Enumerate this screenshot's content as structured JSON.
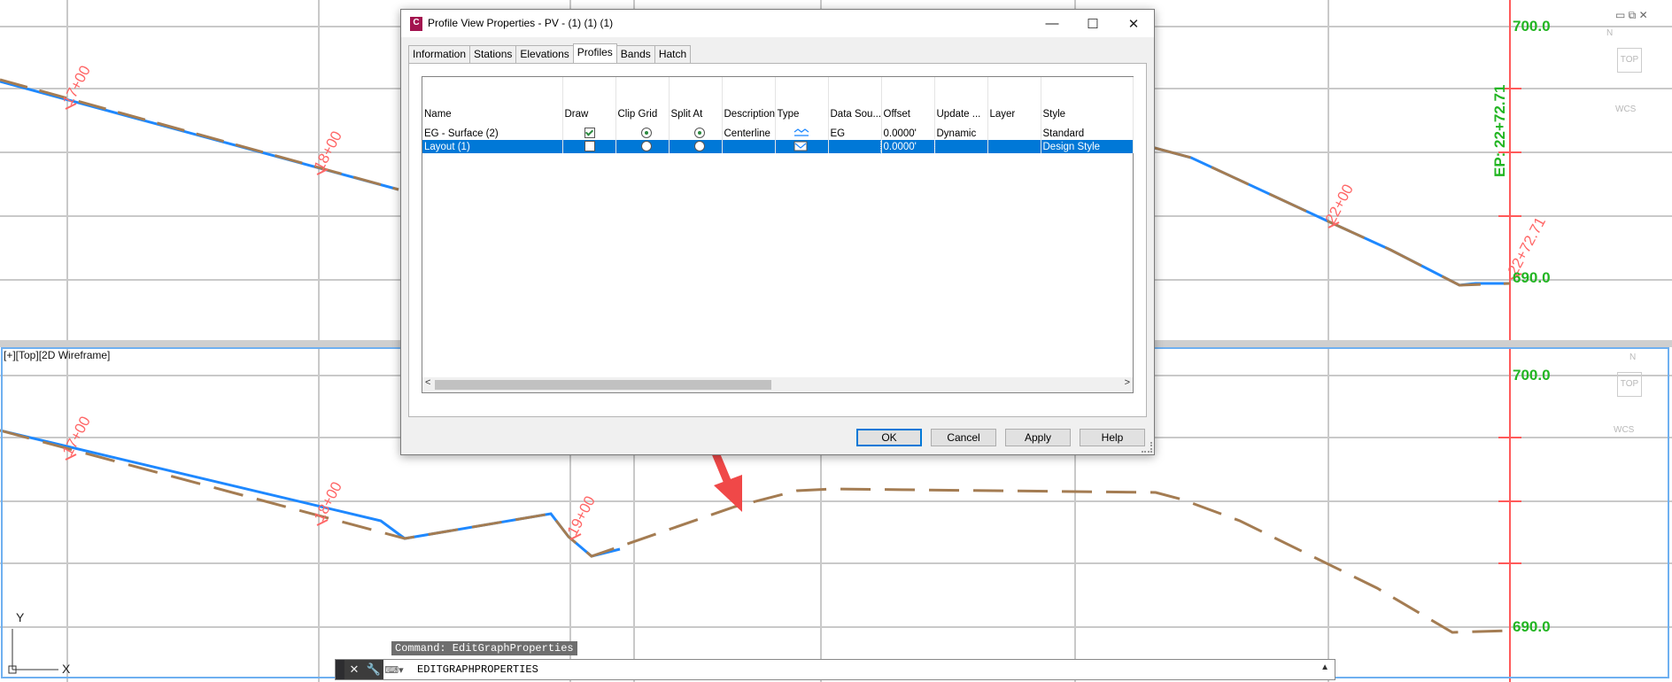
{
  "colors": {
    "grid": "#c9c9c9",
    "stationText": "#ff6666",
    "redLine": "#ff5a5a",
    "surfaceBrown": "#a47c52",
    "layoutBlue": "#1e88ff",
    "elevGreen": "#22b522",
    "arrow": "#f04848"
  },
  "topViewport": {
    "stations": [
      "17+00",
      "18+00",
      "22+00",
      "22+72.71"
    ],
    "elevTop": "700.0",
    "elevBottom": "690.0",
    "endStation": "EP:  22+72.71",
    "viewcube": {
      "top": "TOP",
      "wcs": "WCS"
    }
  },
  "bottomViewport": {
    "label": "[+][Top][2D Wireframe]",
    "stations": [
      "17+00",
      "18+00",
      "19+00"
    ],
    "elevTop": "700.0",
    "elevBottom": "690.0",
    "viewcube": {
      "top": "TOP",
      "wcs": "WCS"
    }
  },
  "ucs": {
    "x": "X",
    "y": "Y"
  },
  "command": {
    "hint": "Command: EditGraphProperties",
    "text": "EDITGRAPHPROPERTIES",
    "close_icon": "close-icon",
    "wrench_icon": "wrench-icon"
  },
  "dialog": {
    "title": "Profile View Properties - PV - (1) (1) (1)",
    "app_icon": "C",
    "tabs": [
      "Information",
      "Stations",
      "Elevations",
      "Profiles",
      "Bands",
      "Hatch"
    ],
    "active_tab": "Profiles",
    "columns": [
      "Name",
      "Draw",
      "Clip Grid",
      "Split At",
      "Description",
      "Type",
      "Data Sou...",
      "Offset",
      "Update ...",
      "Layer",
      "Style"
    ],
    "rows": [
      {
        "name": "EG - Surface (2)",
        "draw": true,
        "clip": true,
        "split": true,
        "description": "Centerline",
        "type": "surface-profile-icon",
        "source": "EG",
        "offset": "0.0000'",
        "update": "Dynamic",
        "layer": "",
        "style": "Standard",
        "selected": false
      },
      {
        "name": "Layout (1)",
        "draw": false,
        "clip": false,
        "split": false,
        "description": "",
        "type": "layout-profile-icon",
        "source": "",
        "offset": "0.0000'",
        "update": "",
        "layer": "",
        "style": "Design Style",
        "selected": true
      }
    ],
    "buttons": {
      "ok": "OK",
      "cancel": "Cancel",
      "apply": "Apply",
      "help": "Help"
    }
  }
}
